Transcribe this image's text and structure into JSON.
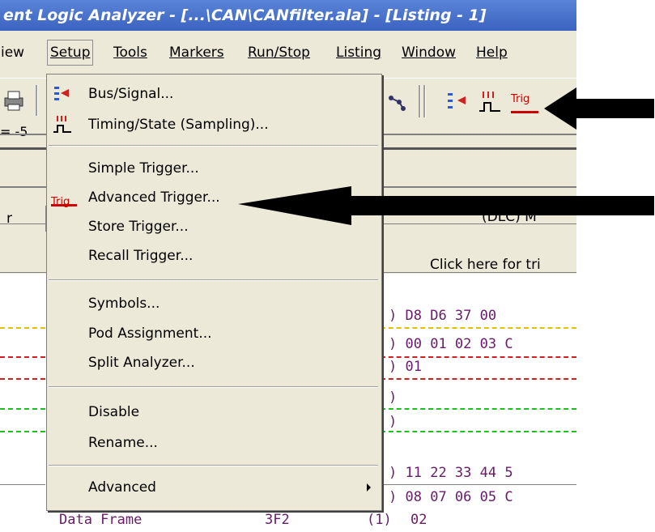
{
  "titlebar": {
    "text": "ent Logic Analyzer  - [...\\CAN\\CANfilter.ala] - [Listing - 1]"
  },
  "menubar": {
    "items": [
      {
        "label": "iew"
      },
      {
        "label": "Setup"
      },
      {
        "label": "Tools"
      },
      {
        "label": "Markers"
      },
      {
        "label": "Run/Stop"
      },
      {
        "label": "Listing"
      },
      {
        "label": "Window"
      },
      {
        "label": "Help"
      }
    ]
  },
  "toolbar": {
    "marker_value": "= -5",
    "trig_label": "Trig"
  },
  "setup_menu": {
    "items": [
      {
        "label": "Bus/Signal...",
        "icon": "bus-signal-icon"
      },
      {
        "label": "Timing/State (Sampling)...",
        "icon": "timing-state-icon"
      },
      {
        "label": "Simple Trigger..."
      },
      {
        "label": "Advanced Trigger...",
        "icon": "trig-icon",
        "icon_text": "Trig"
      },
      {
        "label": "Store Trigger..."
      },
      {
        "label": "Recall Trigger..."
      },
      {
        "label": "Symbols..."
      },
      {
        "label": "Pod Assignment..."
      },
      {
        "label": "Split Analyzer..."
      },
      {
        "label": "Disable"
      },
      {
        "label": "Rename..."
      },
      {
        "label": "Advanced"
      }
    ]
  },
  "listing": {
    "column_header_left": "r",
    "column_header_right": "(DLC) M",
    "click_hint": "Click here for tri",
    "rows": [
      {
        "paren": ")",
        "data": "D8 D6 37 00"
      },
      {
        "paren": ")",
        "data": "00 01 02 03 C"
      },
      {
        "paren": ")",
        "data": "01"
      },
      {
        "paren": ")",
        "data": ""
      },
      {
        "paren": ")",
        "data": ""
      },
      {
        "paren": ")",
        "data": "11 22 33 44 5"
      },
      {
        "paren": ")",
        "data": "08 07 06 05 C"
      }
    ],
    "last_row": {
      "type": "Data Frame",
      "id": "3F2",
      "dlc": "(1)",
      "data": "02"
    }
  },
  "colors": {
    "title_blue": "#3b63c0",
    "trig_red": "#cc0000",
    "listing_text": "#6a1a6a",
    "menu_bg": "#ece9d8"
  }
}
